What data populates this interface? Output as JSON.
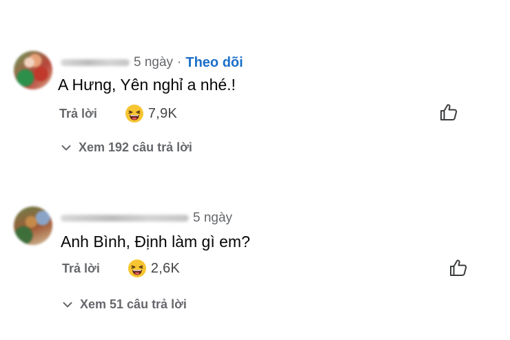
{
  "comments": [
    {
      "time": "5 ngày",
      "separator": "·",
      "follow_label": "Theo dõi",
      "text": "A Hưng, Yên nghỉ a nhé.!",
      "reply_label": "Trả lời",
      "reaction_icon": "laughing-emoji",
      "reaction_count": "7,9K",
      "like_icon": "thumbs-up-icon",
      "view_replies_label": "Xem 192 câu trả lời"
    },
    {
      "time": "5 ngày",
      "text": "Anh Bình, Định làm gì em?",
      "reply_label": "Trả lời",
      "reaction_icon": "laughing-emoji",
      "reaction_count": "2,6K",
      "like_icon": "thumbs-up-icon",
      "view_replies_label": "Xem 51 câu trả lời"
    }
  ],
  "colors": {
    "link": "#1a6fc9",
    "muted": "#65676b",
    "text": "#050505",
    "emoji_face": "#f7c531"
  }
}
